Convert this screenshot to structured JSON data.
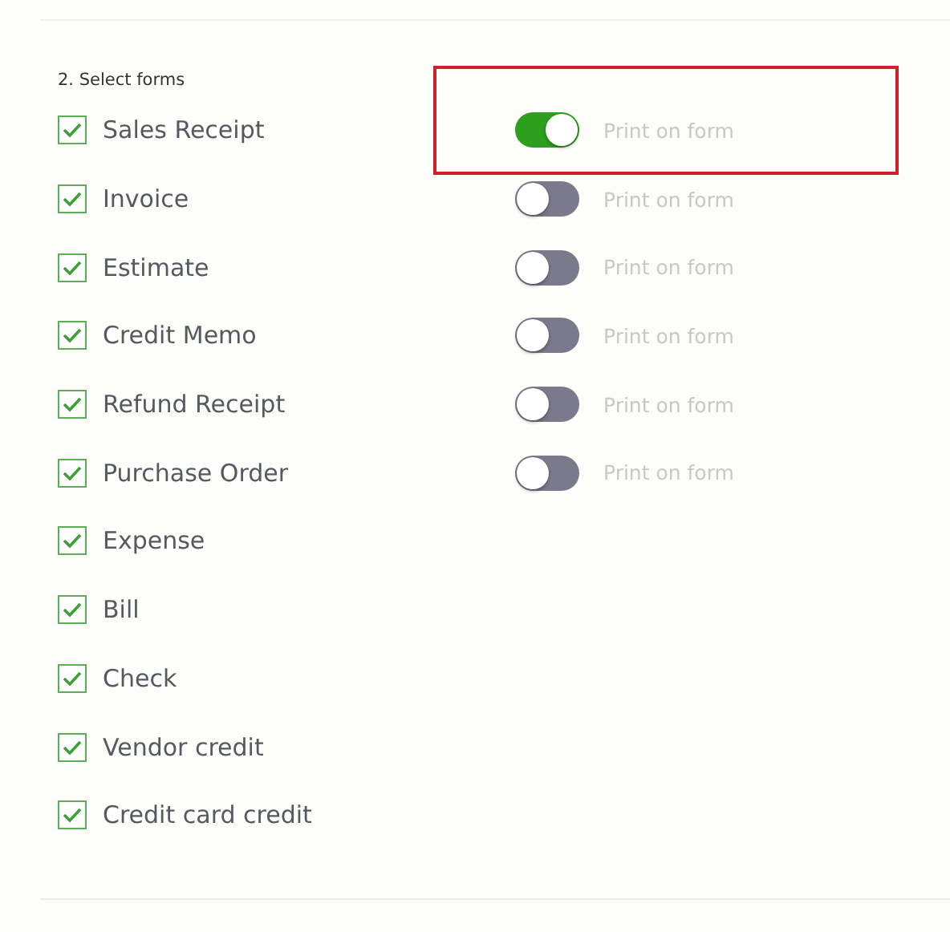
{
  "section": {
    "heading": "2. Select forms",
    "forms": [
      {
        "label": "Sales Receipt",
        "checked": true,
        "highlighted": true,
        "toggle": {
          "on": true,
          "label": "Print on form"
        }
      },
      {
        "label": "Invoice",
        "checked": true,
        "highlighted": false,
        "toggle": {
          "on": false,
          "label": "Print on form"
        }
      },
      {
        "label": "Estimate",
        "checked": true,
        "highlighted": false,
        "toggle": {
          "on": false,
          "label": "Print on form"
        }
      },
      {
        "label": "Credit Memo",
        "checked": true,
        "highlighted": false,
        "toggle": {
          "on": false,
          "label": "Print on form"
        }
      },
      {
        "label": "Refund Receipt",
        "checked": true,
        "highlighted": false,
        "toggle": {
          "on": false,
          "label": "Print on form"
        }
      },
      {
        "label": "Purchase Order",
        "checked": true,
        "highlighted": false,
        "toggle": {
          "on": false,
          "label": "Print on form"
        }
      },
      {
        "label": "Expense",
        "checked": true,
        "highlighted": false
      },
      {
        "label": "Bill",
        "checked": true,
        "highlighted": false
      },
      {
        "label": "Check",
        "checked": true,
        "highlighted": false
      },
      {
        "label": "Vendor credit",
        "checked": true,
        "highlighted": false
      },
      {
        "label": "Credit card credit",
        "checked": true,
        "highlighted": false
      }
    ]
  }
}
